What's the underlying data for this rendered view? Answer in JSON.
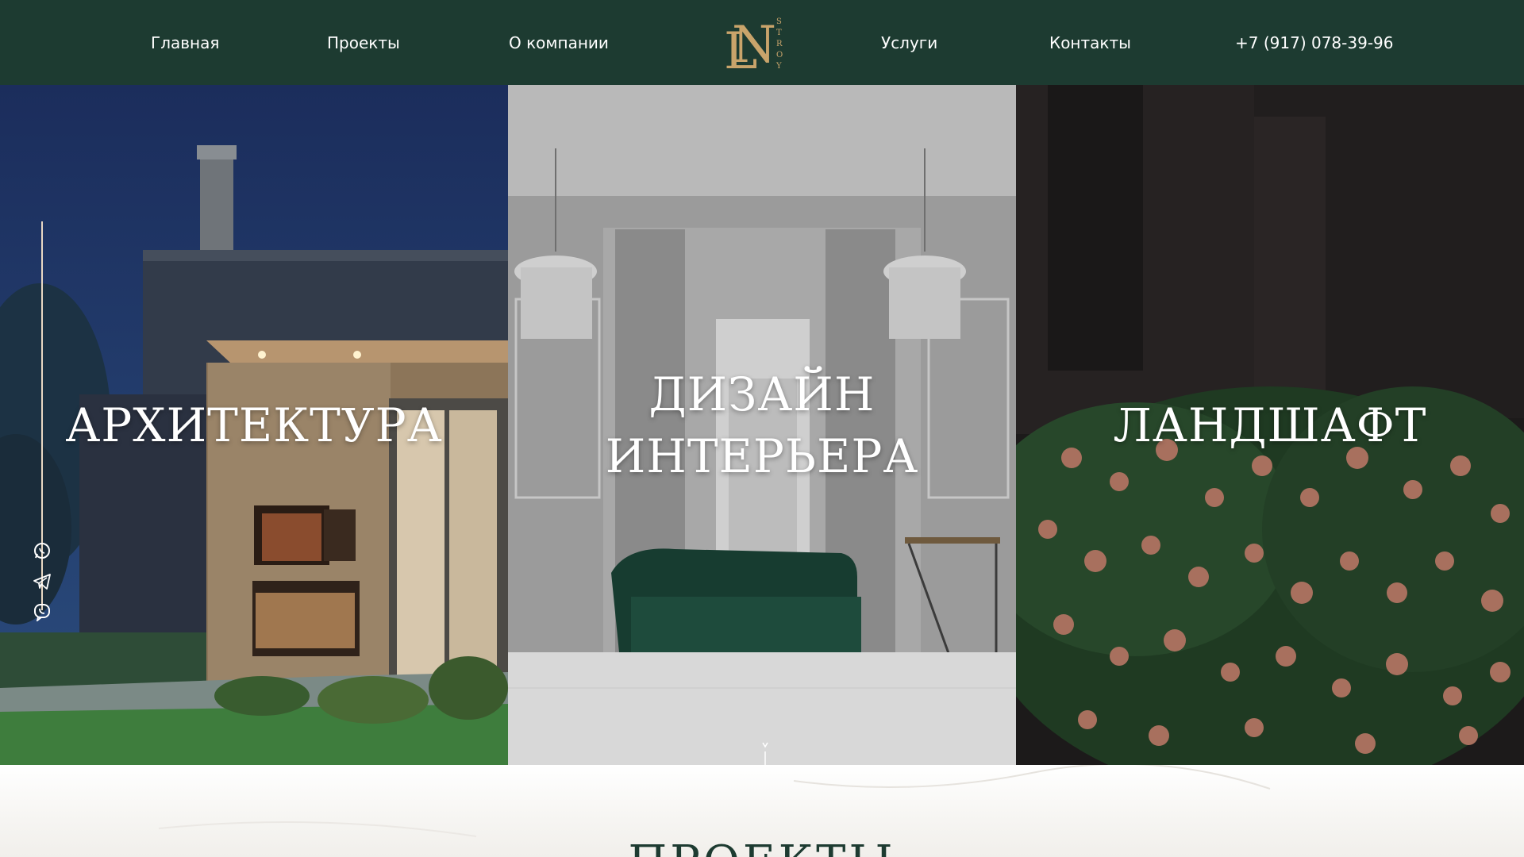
{
  "header": {
    "nav": [
      "Главная",
      "Проекты",
      "О компании",
      "Услуги",
      "Контакты"
    ],
    "phone": "+7 (917) 078-39-96",
    "logo": {
      "letters": "LN",
      "sub": "STROY"
    }
  },
  "hero": {
    "panels": [
      {
        "title_lines": [
          "АРХИТЕКТУРА"
        ]
      },
      {
        "title_lines": [
          "ДИЗАЙН",
          "ИНТЕРЬЕРА"
        ]
      },
      {
        "title_lines": [
          "ЛАНДШАФТ"
        ]
      }
    ],
    "social_icons": [
      "whatsapp-icon",
      "telegram-icon",
      "viber-icon"
    ]
  },
  "section": {
    "title": "ПРОЕКТЫ"
  },
  "colors": {
    "header_bg": "#1d3b31",
    "logo_gold": "#c9a46b",
    "accent_line": "#e9d8c4"
  }
}
